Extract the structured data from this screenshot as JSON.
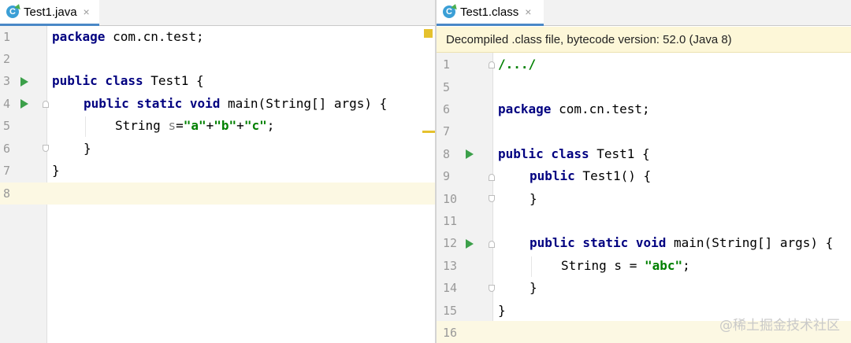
{
  "left_tab": {
    "label": "Test1.java",
    "icon_letter": "C",
    "close": "×"
  },
  "right_tab": {
    "label": "Test1.class",
    "icon_letter": "C",
    "close": "×"
  },
  "banner": {
    "text": "Decompiled .class file, bytecode version: 52.0 (Java 8)"
  },
  "left_lines": [
    "1",
    "2",
    "3",
    "4",
    "5",
    "6",
    "7",
    "8"
  ],
  "left_code": {
    "l1_kw": "package",
    "l1_rest": " com.cn.test;",
    "l3_kw": "public class",
    "l3_rest": " Test1 {",
    "l4_kw": "public static void",
    "l4_rest": " main(String[] args) {",
    "l5_type": "String ",
    "l5_var": "s",
    "l5_eq": "=",
    "l5_a": "\"a\"",
    "l5_p1": "+",
    "l5_b": "\"b\"",
    "l5_p2": "+",
    "l5_c": "\"c\"",
    "l5_end": ";",
    "l6": "}",
    "l7": "}"
  },
  "right_lines": [
    "1",
    "5",
    "6",
    "7",
    "8",
    "9",
    "10",
    "11",
    "12",
    "13",
    "14",
    "15",
    "16"
  ],
  "right_code": {
    "r1": "/.../",
    "r6_kw": "package",
    "r6_rest": " com.cn.test;",
    "r8_kw": "public class",
    "r8_rest": " Test1 {",
    "r9_kw": "public",
    "r9_rest": " Test1() {",
    "r10": "}",
    "r12_kw": "public static void",
    "r12_rest": " main(String[] args) {",
    "r13_a": "String s = ",
    "r13_str": "\"abc\"",
    "r13_end": ";",
    "r14": "}",
    "r15": "}"
  },
  "watermark": "@稀土掘金技术社区",
  "colors": {
    "keyword": "#000080",
    "string": "#008000",
    "run": "#3ca04a",
    "current_line": "#fcf8e3",
    "banner": "#fdf7d8"
  }
}
